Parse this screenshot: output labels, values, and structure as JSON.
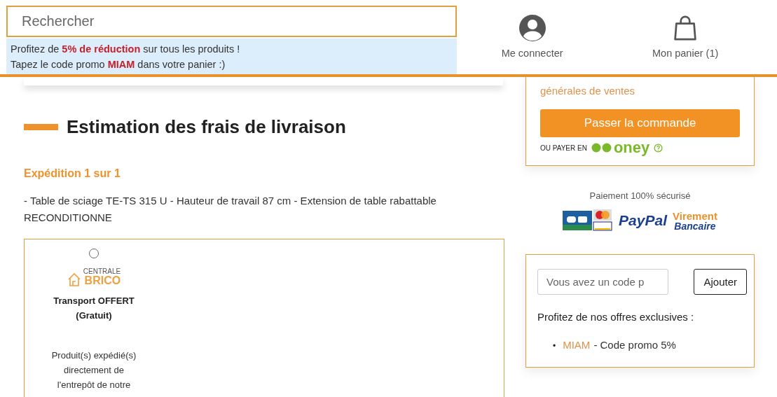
{
  "search": {
    "placeholder": "Rechercher"
  },
  "promo_banner": {
    "lines": [
      "Profitez de **5% de réduction** sur tous les produits !",
      "Tapez le code promo **MIAM** dans votre panier :)"
    ]
  },
  "header_actions": [
    {
      "kind": "account",
      "label": "Me connecter"
    },
    {
      "kind": "cart",
      "label": "Mon panier (1)"
    }
  ],
  "shipping": {
    "title": "Estimation des frais de livraison",
    "shipment_label": "Expédition 1 sur 1",
    "product": "- Table de sciage TE-TS 315 U - Hauteur de travail 87 cm - Extension de table rabattable RECONDITIONNE",
    "options": [
      {
        "selected": false,
        "carrier_top": "CENTRALE",
        "carrier_name": "BRICO",
        "title": "Transport OFFERT",
        "price": "(Gratuit)",
        "description": "Produit(s) expédié(s) directement de l'entrepôt de notre"
      }
    ]
  },
  "order": {
    "terms_link": "générales de ventes",
    "submit": "Passer la commande",
    "alt_payment_label": "OU PAYER EN",
    "alt_payment_brand": "oney"
  },
  "payment": {
    "title": "Paiement 100% sécurisé",
    "logos": [
      {
        "kind": "cards"
      },
      {
        "kind": "paypal",
        "label": "PayPal"
      },
      {
        "kind": "transfer",
        "label": "Virement",
        "sublabel": "Bancaire"
      }
    ]
  },
  "coupon": {
    "placeholder": "Vous avez un code p",
    "button": "Ajouter",
    "offers_title": "Profitez de nos offres exclusives :",
    "offers": [
      {
        "bullet": "•",
        "code": "MIAM",
        "text": "- Code promo 5%"
      }
    ]
  }
}
